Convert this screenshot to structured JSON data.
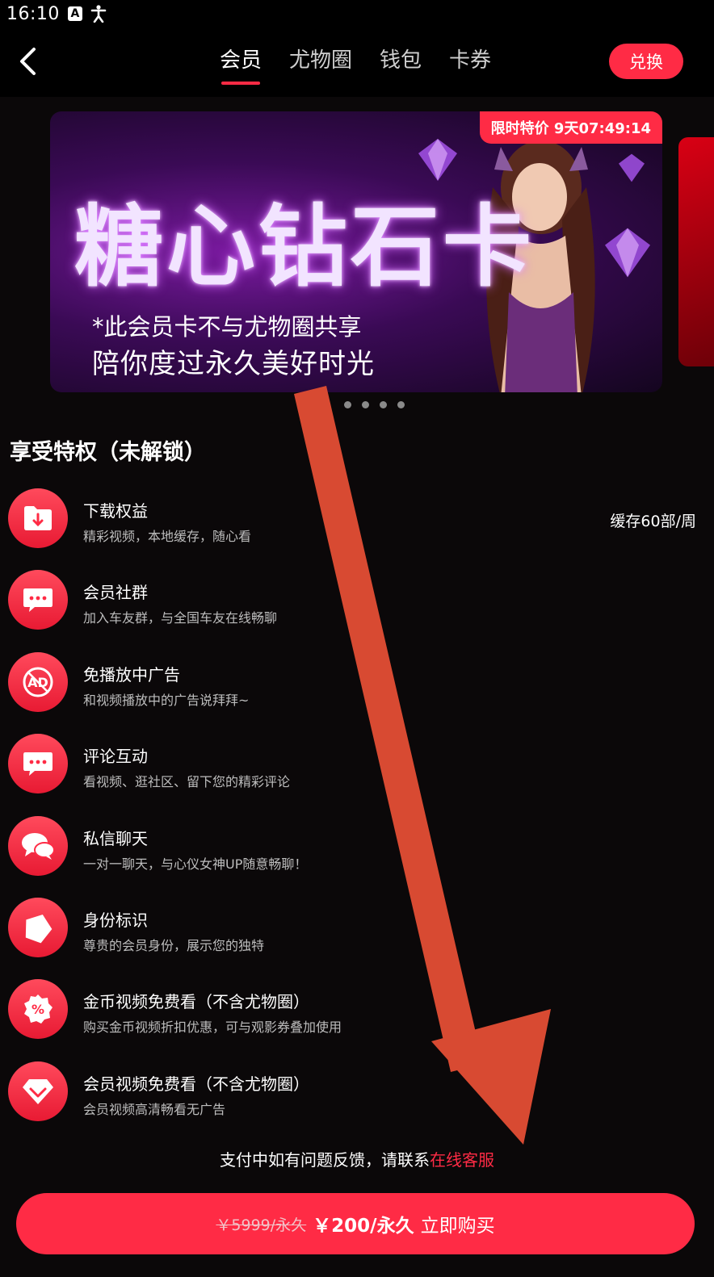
{
  "status_bar": {
    "time": "16:10",
    "icons": [
      "a-icon",
      "accessibility-icon"
    ]
  },
  "header": {
    "tabs": [
      {
        "label": "会员",
        "active": true
      },
      {
        "label": "尤物圈",
        "active": false
      },
      {
        "label": "钱包",
        "active": false
      },
      {
        "label": "卡券",
        "active": false
      }
    ],
    "redeem_label": "兑换"
  },
  "banner": {
    "promo_tag": "限时特价 9天07:49:14",
    "title": "糖心钻石卡",
    "subtitle1": "*此会员卡不与尤物圈共享",
    "subtitle2": "陪你度过永久美好时光",
    "slide_count": 4
  },
  "perks_section": {
    "title": "享受特权（未解锁）",
    "items": [
      {
        "icon": "download-folder-icon",
        "title": "下载权益",
        "desc": "精彩视频，本地缓存，随心看",
        "extra": "缓存60部/周"
      },
      {
        "icon": "chat-bubble-icon",
        "title": "会员社群",
        "desc": "加入车友群，与全国车友在线畅聊"
      },
      {
        "icon": "no-ad-icon",
        "title": "免播放中广告",
        "desc": "和视频播放中的广告说拜拜~"
      },
      {
        "icon": "comment-icon",
        "title": "评论互动",
        "desc": "看视频、逛社区、留下您的精彩评论"
      },
      {
        "icon": "private-message-icon",
        "title": "私信聊天",
        "desc": "一对一聊天，与心仪女神UP随意畅聊！"
      },
      {
        "icon": "identity-tag-icon",
        "title": "身份标识",
        "desc": "尊贵的会员身份，展示您的独特"
      },
      {
        "icon": "discount-badge-icon",
        "title": "金币视频免费看（不含尤物圈）",
        "desc": "购买金币视频折扣优惠，可与观影券叠加使用"
      },
      {
        "icon": "diamond-icon",
        "title": "会员视频免费看（不含尤物圈）",
        "desc": "会员视频高清畅看无广告"
      }
    ]
  },
  "footer": {
    "support_text": "支付中如有问题反馈，请联系",
    "support_link": "在线客服",
    "old_price": "￥5999/永久",
    "new_price": "￥200/永久",
    "buy_label": "立即购买"
  },
  "colors": {
    "accent": "#ff2b45",
    "background": "#0b0809",
    "annotation_arrow": "#d84a32"
  }
}
